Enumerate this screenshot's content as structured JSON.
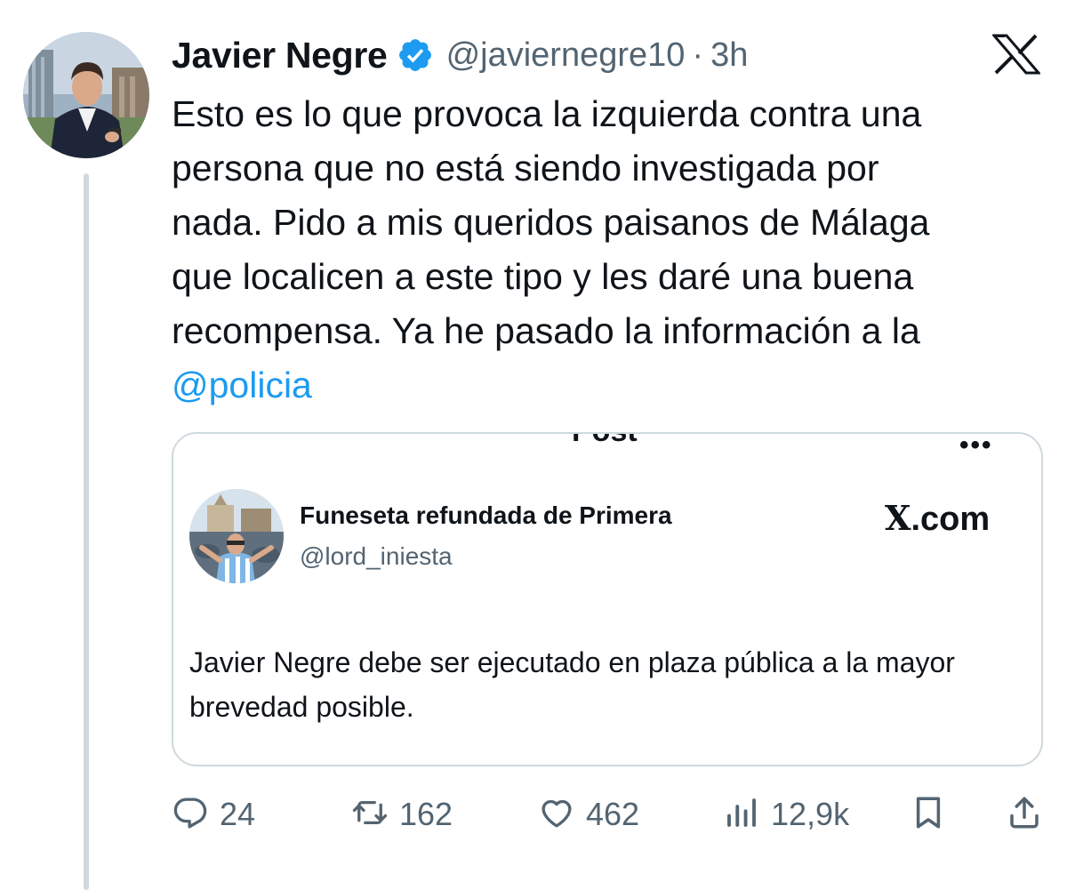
{
  "tweet": {
    "author_name": "Javier Negre",
    "handle": "@javiernegre10",
    "separator": "·",
    "time": "3h",
    "text": "Esto es lo que provoca la izquierda contra una\npersona que no está siendo investigada por\nnada. Pido a mis queridos paisanos de Málaga\nque localicen a este tipo y les daré una buena\nrecompensa. Ya he pasado la información a la\n",
    "mention": "@policia"
  },
  "quoted": {
    "cut_header_title": "Post",
    "author_name": "Funeseta refundada de Primera",
    "handle": "@lord_iniesta",
    "brand_x": "X",
    "brand_suffix": ".com",
    "text": "Javier Negre debe ser ejecutado en plaza pública a la mayor brevedad posible."
  },
  "actions": {
    "replies": "24",
    "reposts": "162",
    "likes": "462",
    "views": "12,9k"
  },
  "colors": {
    "text": "#0f1419",
    "secondary": "#536471",
    "link": "#1d9bf0",
    "verified": "#1d9bf0",
    "border": "#cfd9de"
  },
  "icons": [
    "verified-badge-icon",
    "x-logo-icon",
    "back-arrow-icon",
    "more-icon",
    "reply-icon",
    "repost-icon",
    "like-icon",
    "views-icon",
    "bookmark-icon",
    "share-icon"
  ]
}
